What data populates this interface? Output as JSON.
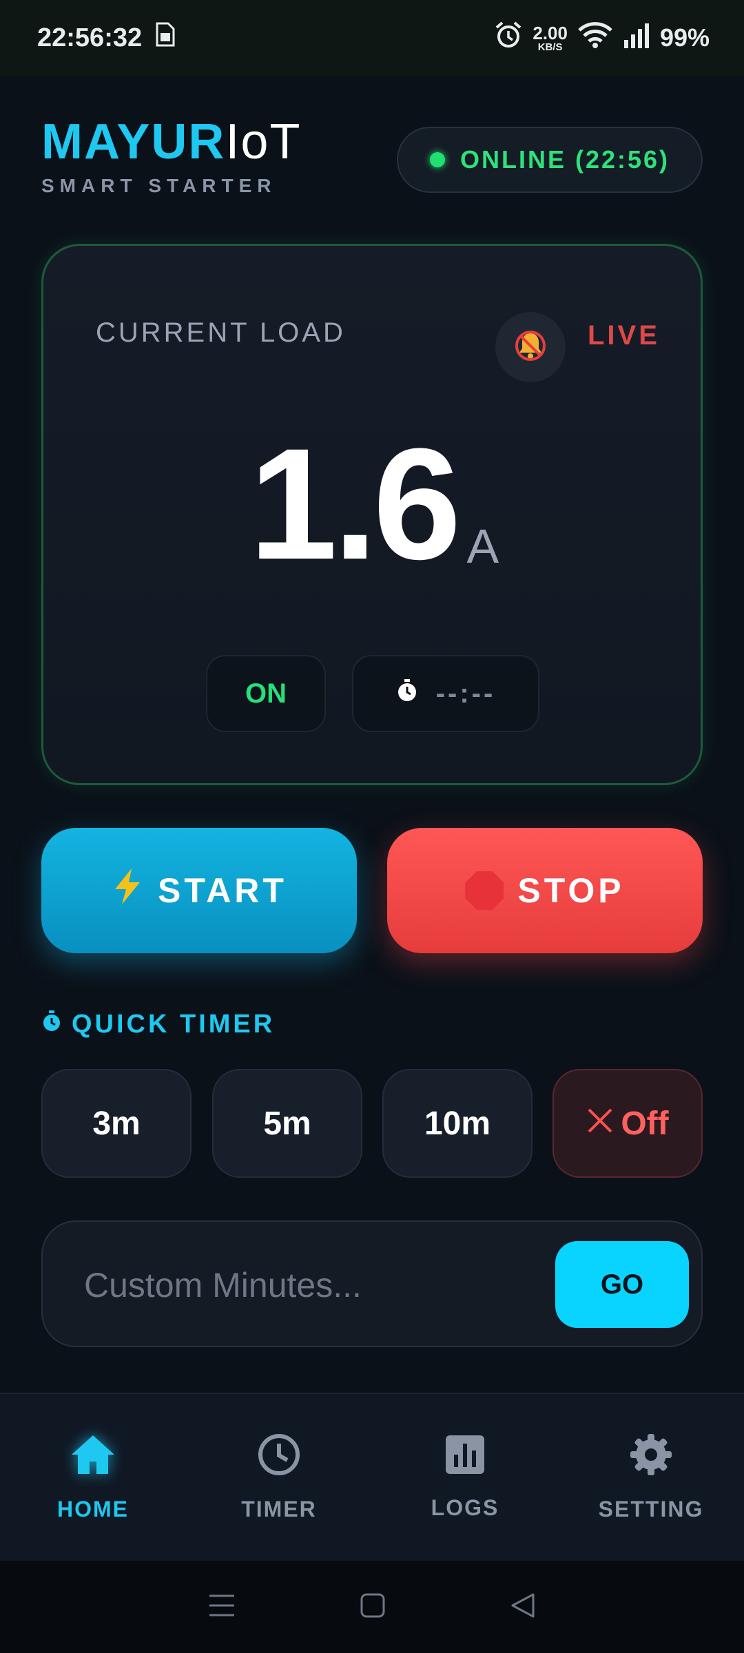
{
  "status_bar": {
    "time": "22:56:32",
    "net_speed_value": "2.00",
    "net_speed_unit": "KB/S",
    "battery": "99%"
  },
  "header": {
    "brand_part1": "MAYUR",
    "brand_part2": "IoT",
    "subtitle": "SMART STARTER",
    "online_status": "ONLINE (22:56)"
  },
  "load_card": {
    "label": "CURRENT LOAD",
    "live_label": "LIVE",
    "value": "1.6",
    "unit": "A",
    "state": "ON",
    "timer": "--:--"
  },
  "controls": {
    "start_label": "START",
    "stop_label": "STOP"
  },
  "quick_timer": {
    "title": "QUICK TIMER",
    "options": [
      "3m",
      "5m",
      "10m"
    ],
    "off_label": "Off"
  },
  "custom": {
    "placeholder": "Custom Minutes...",
    "go_label": "GO"
  },
  "bottom_nav": {
    "items": [
      {
        "label": "HOME",
        "icon": "home-icon",
        "active": true
      },
      {
        "label": "TIMER",
        "icon": "clock-icon",
        "active": false
      },
      {
        "label": "LOGS",
        "icon": "chart-icon",
        "active": false
      },
      {
        "label": "SETTING",
        "icon": "gear-icon",
        "active": false
      }
    ]
  },
  "colors": {
    "accent": "#1ec8f0",
    "online": "#20e070",
    "stop": "#e63c3c",
    "background": "#0b1119"
  }
}
